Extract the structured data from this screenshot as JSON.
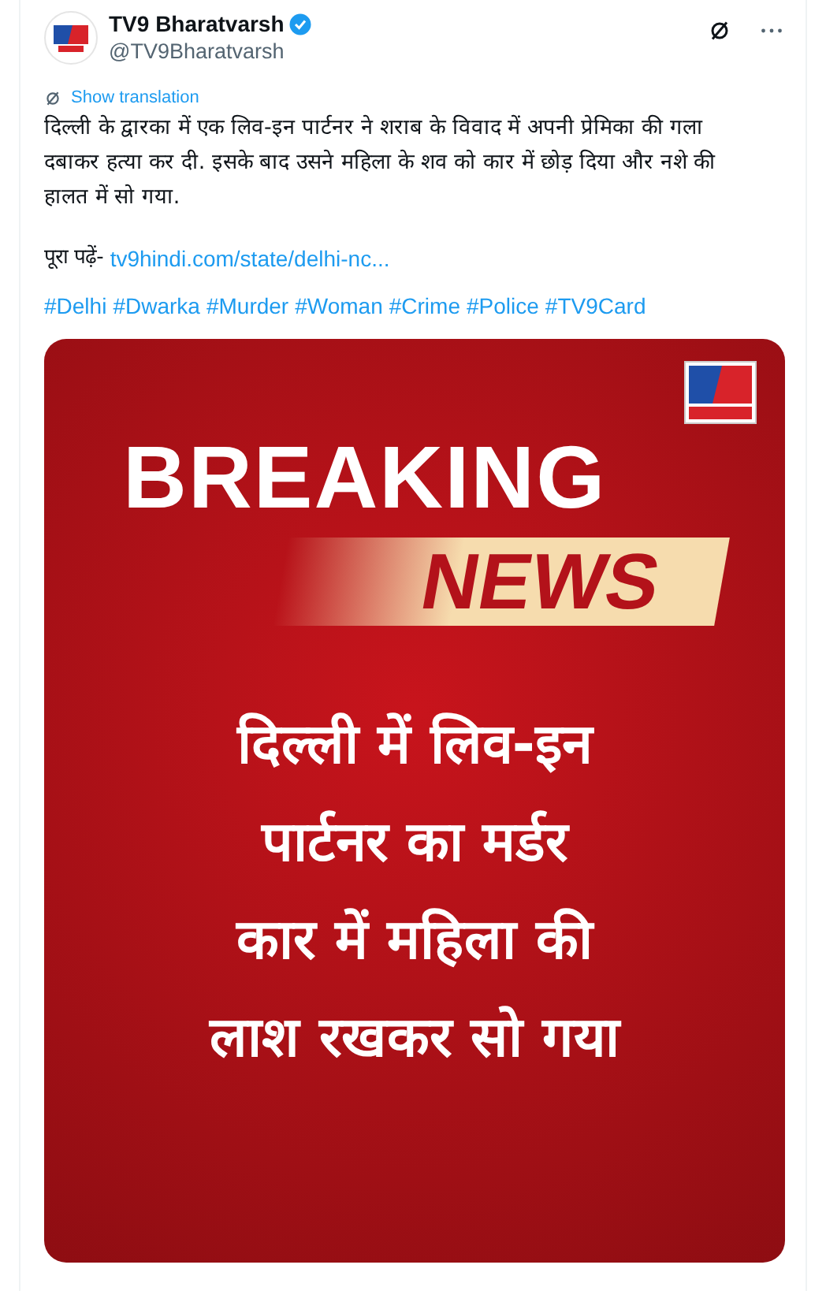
{
  "tweet": {
    "author": {
      "name": "TV9 Bharatvarsh",
      "handle": "@TV9Bharatvarsh",
      "verified": true
    },
    "translate_label": "Show translation",
    "body": "दिल्ली के द्वारका में एक लिव-इन पार्टनर ने शराब के विवाद में अपनी प्रेमिका की गला दबाकर हत्या कर दी. इसके बाद उसने महिला के शव को कार में छोड़ दिया और नशे की हालत में सो गया.",
    "read_more_label": "पूरा पढ़ें-",
    "link": "tv9hindi.com/state/delhi-nc...",
    "hashtags": [
      "#Delhi",
      "#Dwarka",
      "#Murder",
      "#Woman",
      "#Crime",
      "#Police",
      "#TV9Card"
    ],
    "card": {
      "headline_1": "BREAKING",
      "headline_2": "NEWS",
      "lines": [
        "दिल्ली में लिव-इन",
        "पार्टनर का मर्डर",
        "कार में महिला की",
        "लाश रखकर सो गया"
      ]
    }
  }
}
